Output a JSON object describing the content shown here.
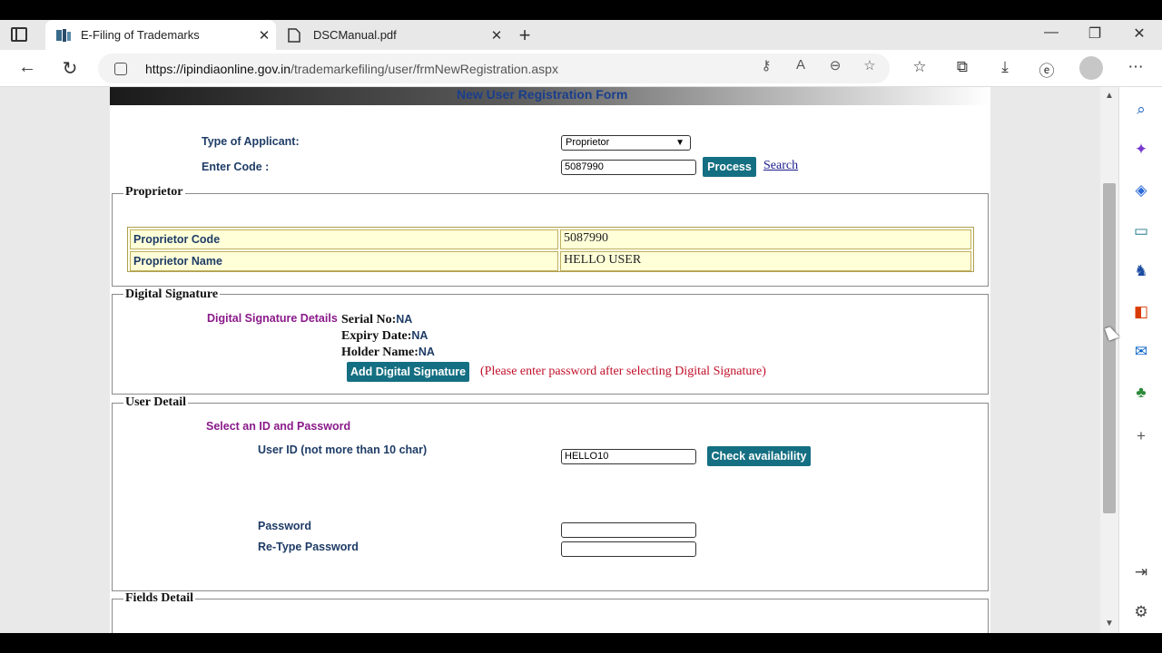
{
  "browser": {
    "tabs": [
      {
        "title": "E-Filing of Trademarks",
        "active": true
      },
      {
        "title": "DSCManual.pdf",
        "active": false
      }
    ],
    "url_host": "https://ipindiaonline.gov.in",
    "url_path": "/trademarkefiling/user/frmNewRegistration.aspx",
    "window_controls": {
      "minimize": "—",
      "restore": "❐",
      "close": "✕"
    }
  },
  "form": {
    "header_title": "New User Registration Form",
    "type_of_applicant_label": "Type of Applicant:",
    "type_of_applicant_value": "Proprietor",
    "enter_code_label": "Enter Code :",
    "enter_code_value": "5087990",
    "process_button": "Process",
    "search_link": "Search",
    "proprietor_section": {
      "legend": "Proprietor",
      "rows": [
        {
          "label": "Proprietor Code",
          "value": "5087990"
        },
        {
          "label": "Proprietor Name",
          "value": "HELLO USER"
        }
      ]
    },
    "digital_signature_section": {
      "legend": "Digital Signature",
      "details_label": "Digital Signature Details",
      "serial_label": "Serial No:",
      "serial_value": "NA",
      "expiry_label": "Expiry Date:",
      "expiry_value": "NA",
      "holder_label": "Holder Name:",
      "holder_value": "NA",
      "add_button": "Add Digital Signature",
      "note": "(Please enter password after selecting Digital Signature)"
    },
    "user_detail_section": {
      "legend": "User Detail",
      "subheading": "Select an ID and Password",
      "user_id_label": "User ID (not more than 10 char)",
      "user_id_value": "HELLO10",
      "check_button": "Check availability",
      "password_label": "Password",
      "password_value": "",
      "retype_label": "Re-Type Password",
      "retype_value": ""
    },
    "fields_detail_section": {
      "legend": "Fields Detail"
    }
  },
  "colors": {
    "button_teal": "#156f82",
    "label_blue": "#1e3c66",
    "purple": "#8a1a8a",
    "note_red": "#c0102a",
    "highlight_yellow": "#ffffd8"
  }
}
